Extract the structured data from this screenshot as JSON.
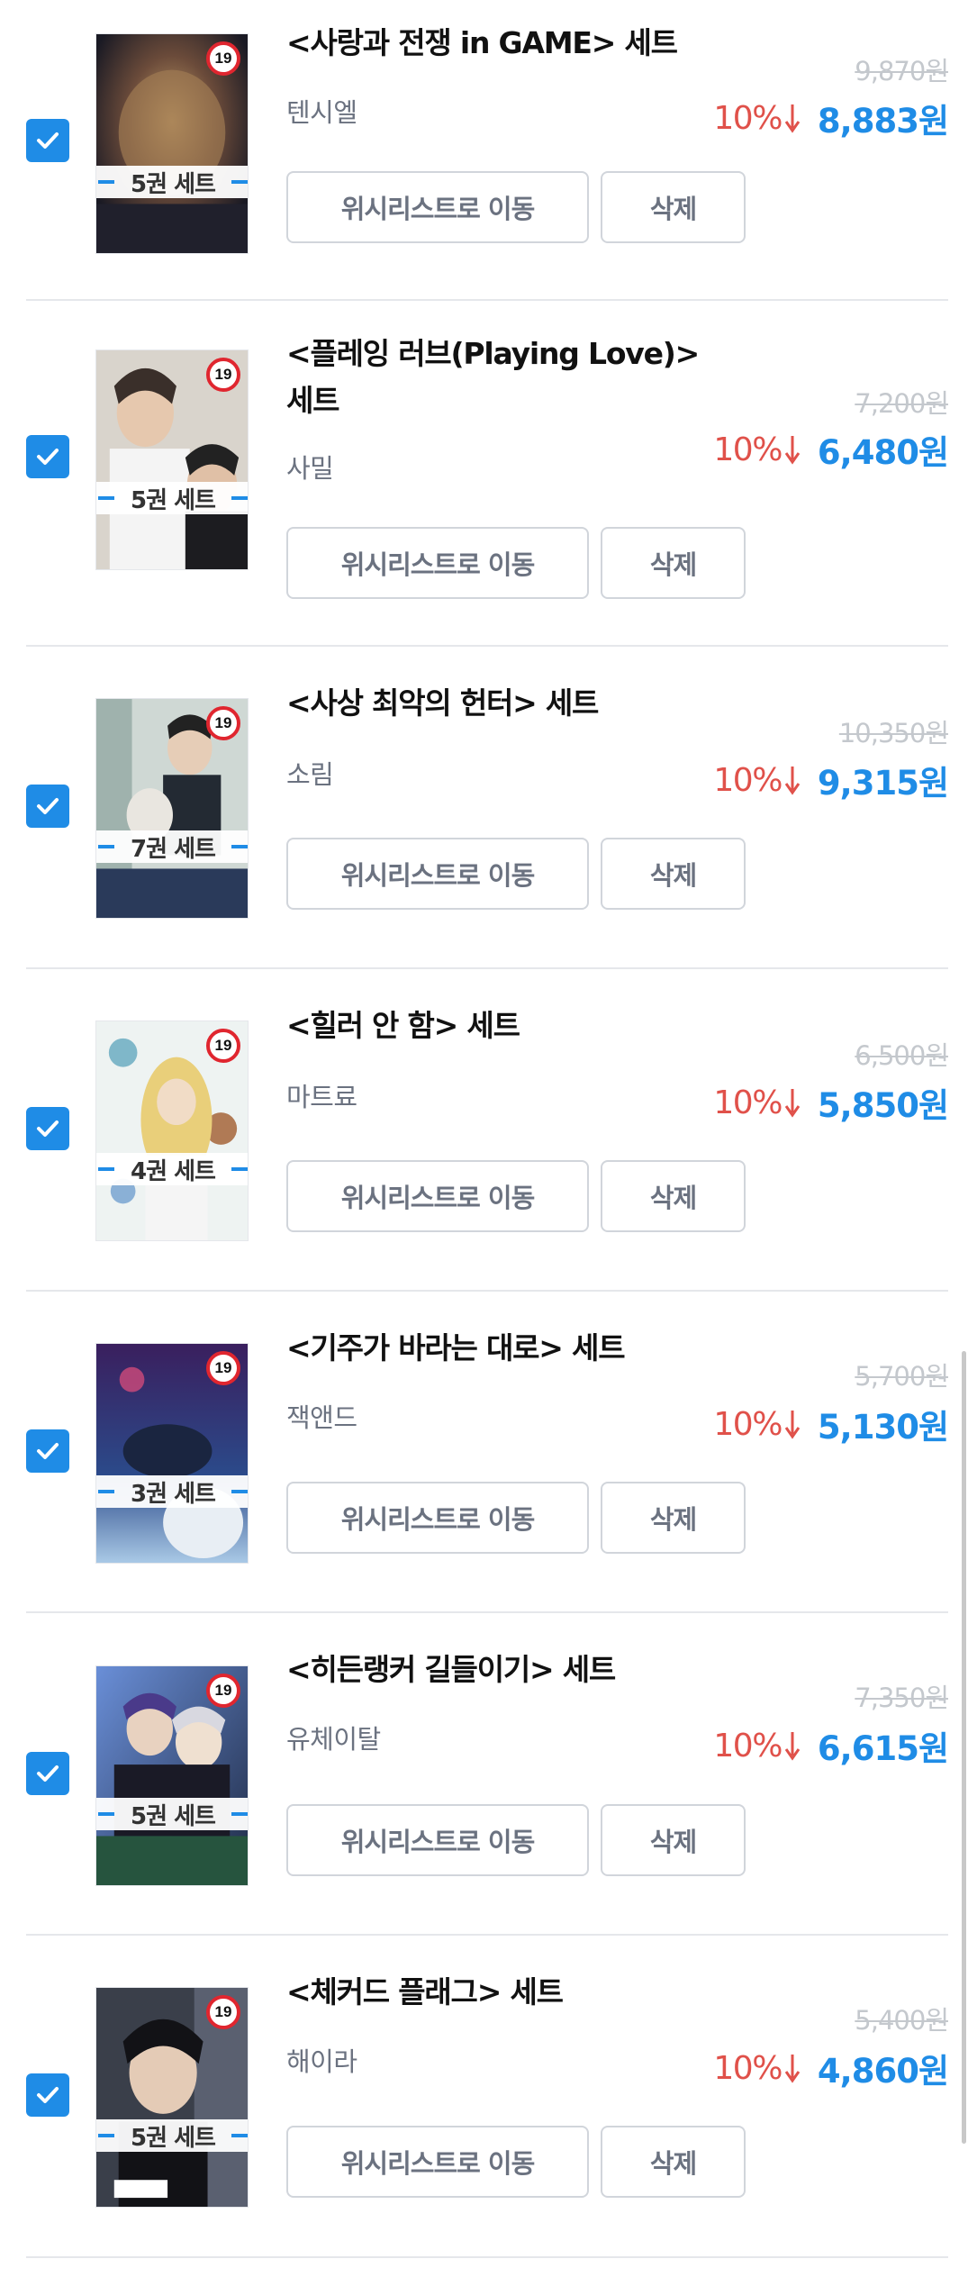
{
  "colors": {
    "accent": "#1f8ce6",
    "discount": "#e0514a",
    "original_price": "#c4c8cd",
    "age_badge": "#e0262f"
  },
  "icons": {
    "checkbox": "checkmark-icon",
    "discount": "arrow-down-icon",
    "age": "age-19-badge"
  },
  "actions": {
    "wishlist_label": "위시리스트로 이동",
    "delete_label": "삭제"
  },
  "items": [
    {
      "title": "<사랑과 전쟁 in GAME> 세트",
      "author": "텐시엘",
      "set_count": "5권 세트",
      "age_rating": "19",
      "original_price": "9,870원",
      "discount": "10%",
      "price": "8,883원",
      "checked": true
    },
    {
      "title": "<플레잉 러브(Playing Love)> 세트",
      "author": "사밀",
      "set_count": "5권 세트",
      "age_rating": "19",
      "original_price": "7,200원",
      "discount": "10%",
      "price": "6,480원",
      "checked": true
    },
    {
      "title": "<사상 최악의 헌터> 세트",
      "author": "소림",
      "set_count": "7권 세트",
      "age_rating": "19",
      "original_price": "10,350원",
      "discount": "10%",
      "price": "9,315원",
      "checked": true
    },
    {
      "title": "<힐러 안 함> 세트",
      "author": "마트료",
      "set_count": "4권 세트",
      "age_rating": "19",
      "original_price": "6,500원",
      "discount": "10%",
      "price": "5,850원",
      "checked": true
    },
    {
      "title": "<기주가 바라는 대로> 세트",
      "author": "잭앤드",
      "set_count": "3권 세트",
      "age_rating": "19",
      "original_price": "5,700원",
      "discount": "10%",
      "price": "5,130원",
      "checked": true
    },
    {
      "title": "<히든랭커 길들이기> 세트",
      "author": "유체이탈",
      "set_count": "5권 세트",
      "age_rating": "19",
      "original_price": "7,350원",
      "discount": "10%",
      "price": "6,615원",
      "checked": true
    },
    {
      "title": "<체커드 플래그> 세트",
      "author": "해이라",
      "set_count": "5권 세트",
      "age_rating": "19",
      "original_price": "5,400원",
      "discount": "10%",
      "price": "4,860원",
      "checked": true
    }
  ]
}
